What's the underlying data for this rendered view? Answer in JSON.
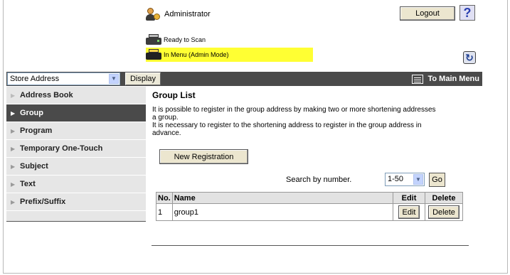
{
  "header": {
    "user_label": "Administrator",
    "logout_label": "Logout",
    "help_label": "?",
    "status_ready": "Ready to Scan",
    "status_mode": "In Menu (Admin Mode)"
  },
  "toolbar": {
    "store_select_value": "Store Address",
    "display_label": "Display",
    "main_menu_label": "To Main Menu"
  },
  "sidebar": {
    "items": [
      {
        "label": "Address Book",
        "active": false
      },
      {
        "label": "Group",
        "active": true
      },
      {
        "label": "Program",
        "active": false
      },
      {
        "label": "Temporary One-Touch",
        "active": false
      },
      {
        "label": "Subject",
        "active": false
      },
      {
        "label": "Text",
        "active": false
      },
      {
        "label": "Prefix/Suffix",
        "active": false
      }
    ]
  },
  "main": {
    "title": "Group List",
    "desc_line1": "It is possible to register in the group address by making two or more shortening addresses",
    "desc_line2": "a group.",
    "desc_line3": "It is necessary to register to the shortening address to register in the group address in",
    "desc_line4": "advance.",
    "new_registration_label": "New Registration",
    "search_label": "Search by number.",
    "search_range_value": "1-50",
    "go_label": "Go",
    "table": {
      "headers": [
        "No.",
        "Name",
        "Edit",
        "Delete"
      ],
      "rows": [
        {
          "no": "1",
          "name": "group1",
          "edit": "Edit",
          "delete": "Delete"
        }
      ]
    }
  },
  "colors": {
    "toolbar_bg": "#4a4a4a",
    "sidebar_bg": "#e6e6e6",
    "status_highlight": "#ffff33",
    "button_bg": "#ece6cf"
  }
}
